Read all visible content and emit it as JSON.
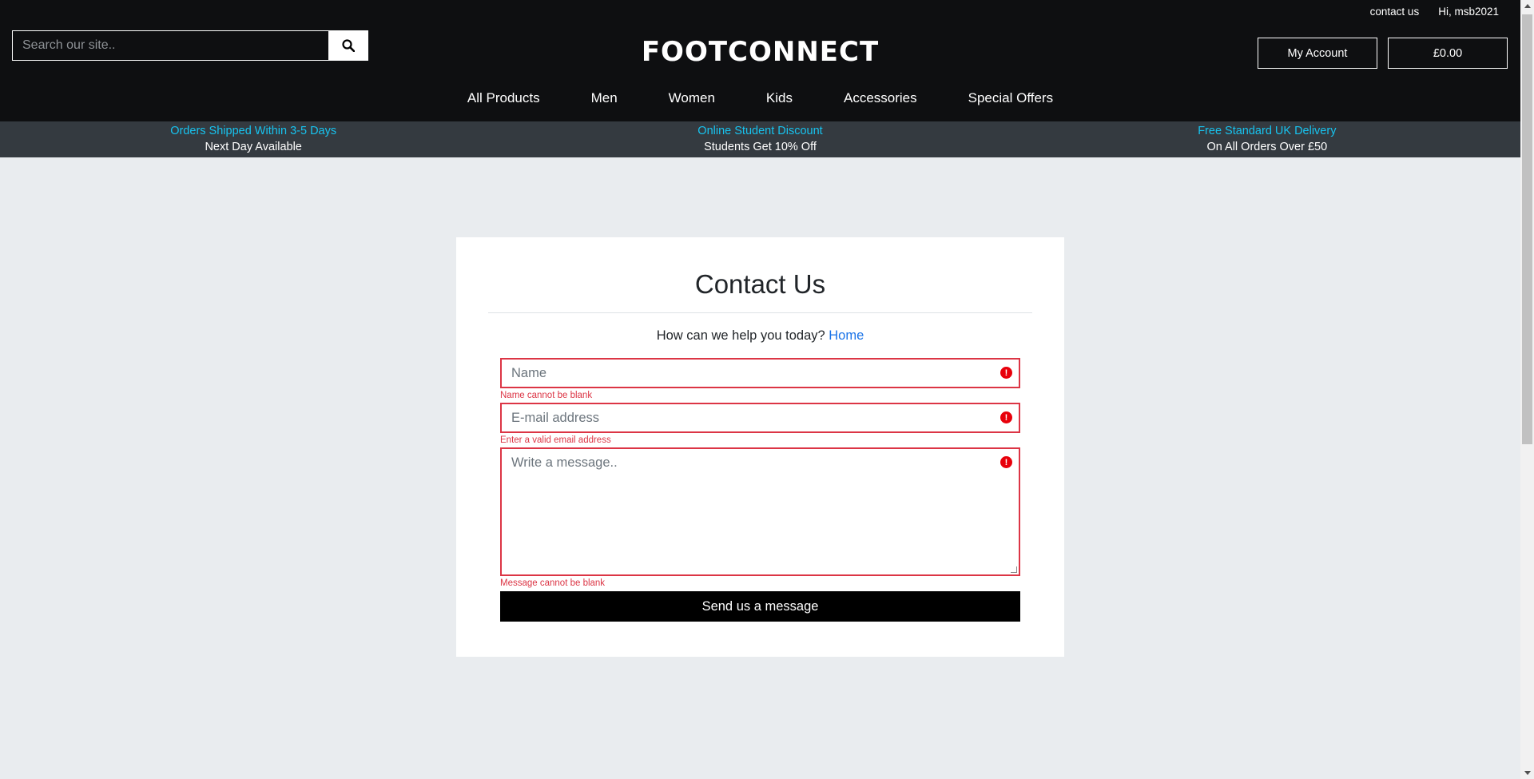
{
  "header": {
    "top_links": {
      "contact": "contact us",
      "greeting": "Hi, msb2021"
    },
    "search": {
      "placeholder": "Search our site.."
    },
    "logo": "FOOTCONNECT",
    "my_account": "My Account",
    "cart": "£0.00",
    "nav": [
      "All Products",
      "Men",
      "Women",
      "Kids",
      "Accessories",
      "Special Offers"
    ]
  },
  "banner": [
    {
      "title": "Orders Shipped Within 3-5 Days",
      "sub": "Next Day Available"
    },
    {
      "title": "Online Student Discount",
      "sub": "Students Get 10% Off"
    },
    {
      "title": "Free Standard UK Delivery",
      "sub": "On All Orders Over £50"
    }
  ],
  "contact": {
    "title": "Contact Us",
    "subtitle": "How can we help you today?",
    "home_link": "Home",
    "name_placeholder": "Name",
    "name_error": "Name cannot be blank",
    "email_placeholder": "E-mail address",
    "email_error": "Enter a valid email address",
    "message_placeholder": "Write a message..",
    "message_error": "Message cannot be blank",
    "submit": "Send us a message",
    "error_icon": "!"
  },
  "colors": {
    "accent_cyan": "#17c3ef",
    "error_red": "#dc3545",
    "link_blue": "#1a73e8"
  }
}
